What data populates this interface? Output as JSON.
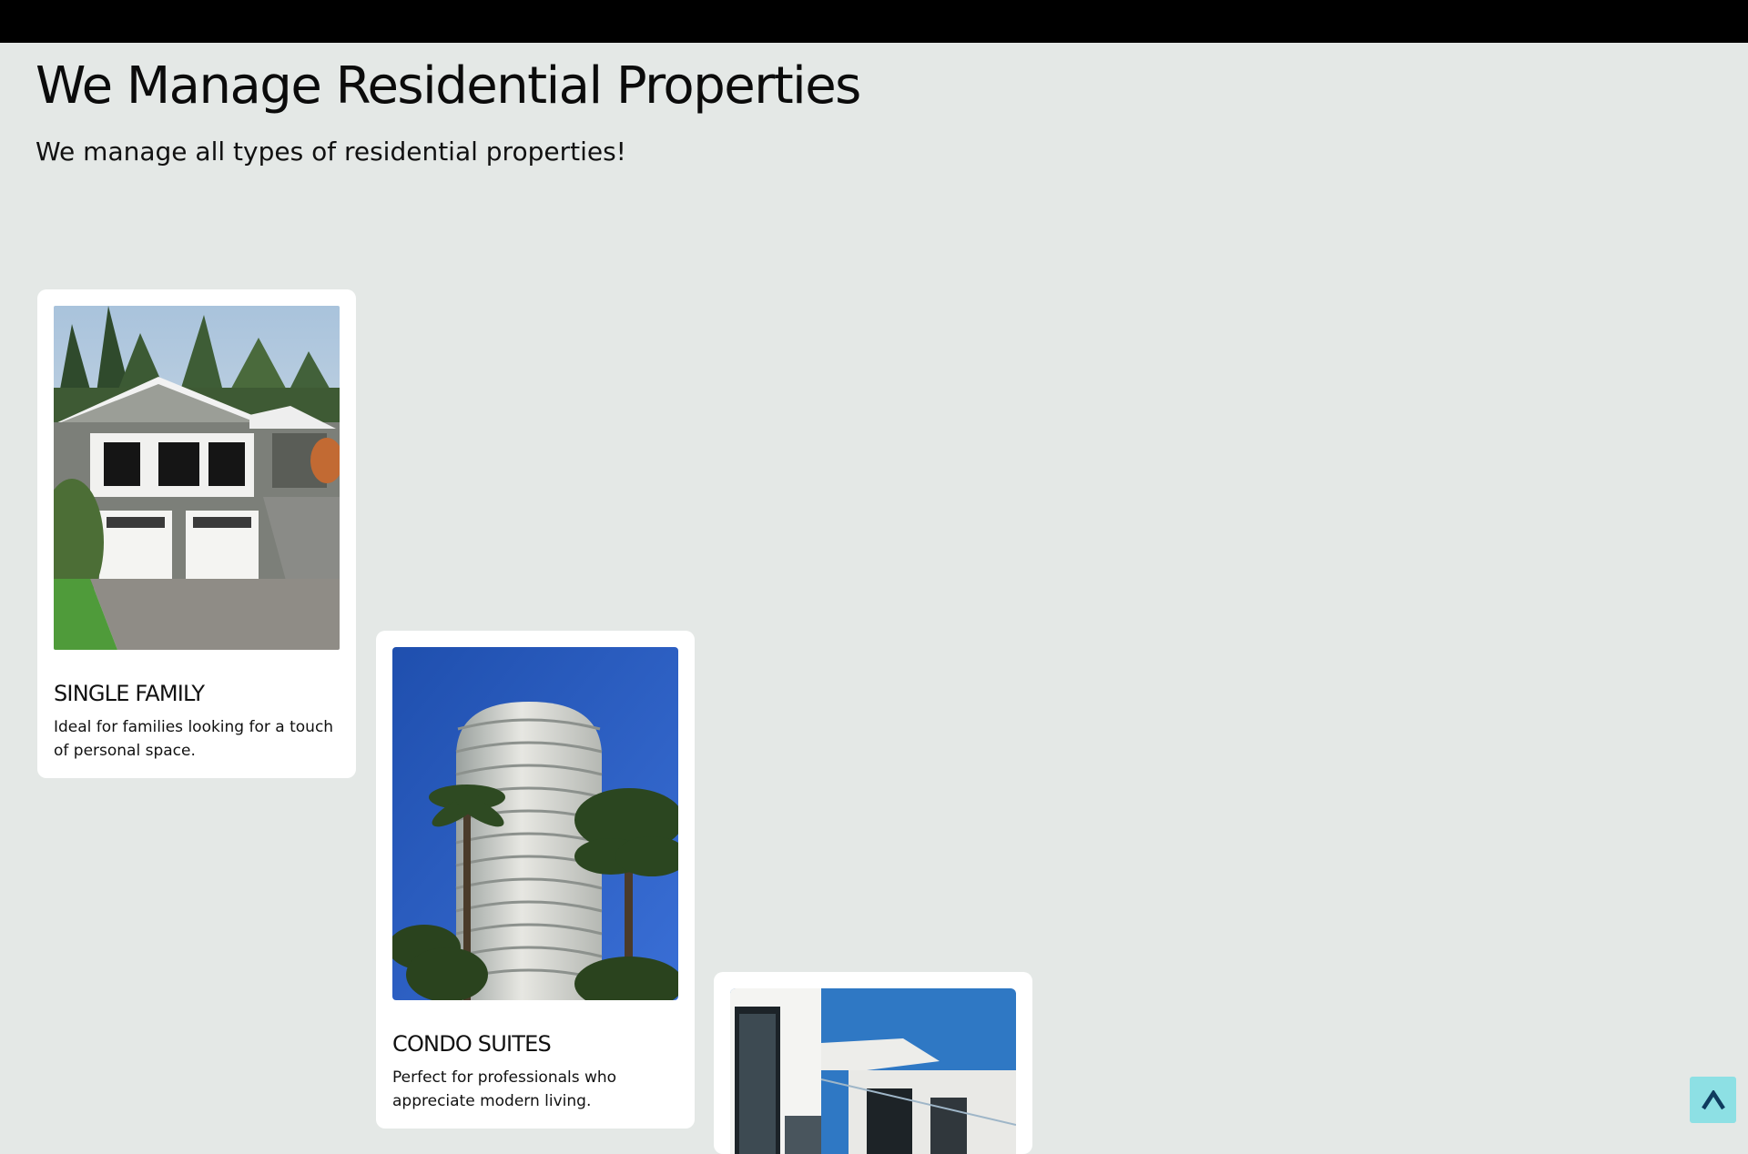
{
  "header": {
    "title": "We Manage Residential Properties",
    "subtitle": "We manage all types of residential properties!"
  },
  "cards": [
    {
      "title": "SINGLE FAMILY",
      "description": "Ideal for families looking for a touch of personal space.",
      "image_icon": "house-photo"
    },
    {
      "title": "CONDO SUITES",
      "description": "Perfect for professionals who appreciate modern living.",
      "image_icon": "condo-tower-photo"
    },
    {
      "title": "",
      "description": "",
      "image_icon": "modern-building-photo"
    }
  ],
  "scroll_top": {
    "icon": "chevron-up-icon",
    "color": "#8de0e4"
  },
  "colors": {
    "background": "#e4e8e6",
    "topbar": "#000000",
    "card": "#ffffff"
  }
}
